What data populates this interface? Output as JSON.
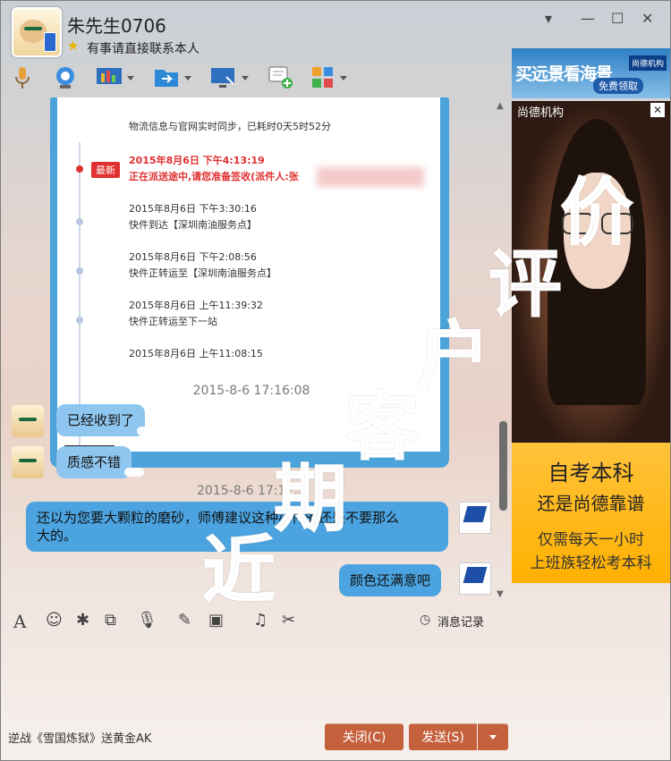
{
  "window": {
    "contact_name": "朱先生0706",
    "signature": "有事请直接联系本人",
    "controls": {
      "menu": "▾",
      "minimize": "—",
      "maximize": "☐",
      "close": "✕"
    }
  },
  "toolbar": {
    "icons": [
      "microphone-icon",
      "video-icon",
      "remote-assist-icon",
      "file-transfer-icon",
      "screen-share-icon",
      "add-chat-icon",
      "apps-icon"
    ]
  },
  "chat": {
    "card": {
      "sync_note": "物流信息与官网实时同步，已耗时0天5时52分",
      "badge": "最新",
      "events": [
        {
          "time": "2015年8月6日 下午4:13:19",
          "desc": "正在派送途中,请您准备签收(派件人:张"
        },
        {
          "time": "2015年8月6日 下午3:30:16",
          "desc": "快件到达【深圳南油服务点】"
        },
        {
          "time": "2015年8月6日 下午2:08:56",
          "desc": "快件正转运至【深圳南油服务点】"
        },
        {
          "time": "2015年8月6日 上午11:39:32",
          "desc": "快件正转运至下一站"
        },
        {
          "time": "2015年8月6日 上午11:08:15",
          "desc": ""
        }
      ]
    },
    "timestamp1": "2015-8-6 17:16:08",
    "msg_in_1": "已经收到了",
    "msg_in_2": "质感不错",
    "timestamp2": "2015-8-6 17:17:5",
    "msg_out_1_line1": "还以为您要大颗粒的磨砂，师傅建议这种小件的还是不要那么",
    "msg_out_1_line2": "大的。",
    "msg_out_2": "颜色还满意吧"
  },
  "editor": {
    "history_label": "消息记录",
    "icons": [
      "font-icon",
      "emoji-icon",
      "magic-icon",
      "screenshot-icon",
      "voice-icon",
      "edit-icon",
      "image-icon",
      "music-icon",
      "scissors-icon"
    ]
  },
  "footer": {
    "promo": "逆战《雪国炼狱》送黄金AK",
    "close_label": "关闭(C)",
    "send_label": "发送(S)"
  },
  "ads": {
    "top_line": "买远景看海景",
    "top_cta": "免费领取",
    "top_logo": "尚德机构",
    "side_label": "尚德机构",
    "side_close": "✕",
    "line1": "自考本科",
    "line2": "还是尚德靠谱",
    "line3": "仅需每天一小时",
    "line4": "上班族轻松考本科"
  },
  "watermark": [
    "近",
    "期",
    "客",
    "户",
    "评",
    "价"
  ]
}
